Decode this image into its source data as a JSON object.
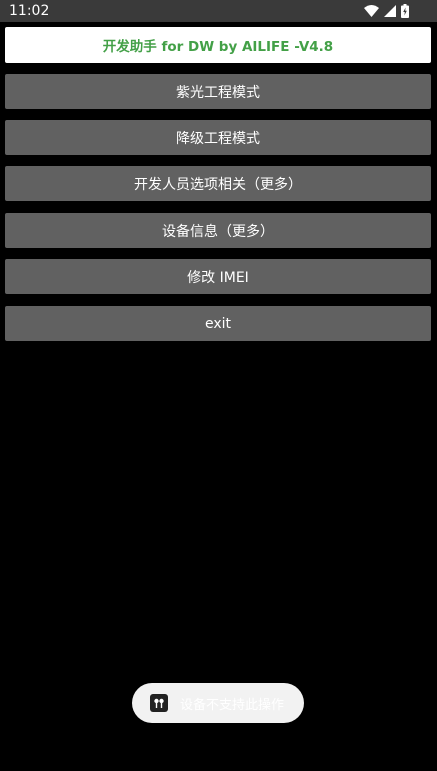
{
  "status_bar": {
    "time": "11:02"
  },
  "header": {
    "title": "开发助手 for DW by AILIFE -V4.8",
    "accent_color": "#43a047"
  },
  "menu": {
    "items": [
      {
        "label": "紫光工程模式"
      },
      {
        "label": "降级工程模式"
      },
      {
        "label": "开发人员选项相关（更多）"
      },
      {
        "label": "设备信息（更多）"
      },
      {
        "label": "修改 IMEI"
      },
      {
        "label": "exit"
      }
    ]
  },
  "toast": {
    "message": "设备不支持此操作",
    "icon": "app-icon"
  },
  "colors": {
    "background": "#000000",
    "button": "#616161",
    "status_bar": "#3a3a3a"
  }
}
